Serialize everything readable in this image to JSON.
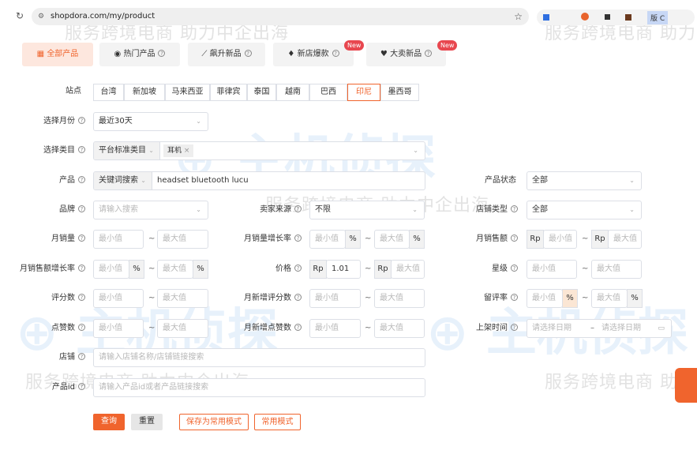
{
  "browser": {
    "url": "shopdora.com/my/product",
    "ext_label": "版 C"
  },
  "watermark": {
    "slogan": "服务跨境电商 助力中企出海",
    "logo": "主机侦探"
  },
  "tabs": [
    {
      "label": "全部产品",
      "icon": "grid-icon"
    },
    {
      "label": "热门产品",
      "icon": "award-icon"
    },
    {
      "label": "飙升新品",
      "icon": "trend-up-icon"
    },
    {
      "label": "新店爆款",
      "icon": "flame-icon",
      "badge": "New"
    },
    {
      "label": "大卖新品",
      "icon": "trophy-icon",
      "badge": "New"
    }
  ],
  "station": {
    "label": "站点",
    "options": [
      "台湾",
      "新加坡",
      "马来西亚",
      "菲律宾",
      "泰国",
      "越南",
      "巴西",
      "印尼",
      "墨西哥"
    ],
    "selected": "印尼"
  },
  "month": {
    "label": "选择月份",
    "value": "最近30天"
  },
  "category": {
    "label": "选择类目",
    "type": "平台标准类目",
    "tag": "耳机"
  },
  "product": {
    "label": "产品",
    "mode": "关键词搜索",
    "value": "headset bluetooth lucu"
  },
  "product_status": {
    "label": "产品状态",
    "value": "全部"
  },
  "brand": {
    "label": "品牌",
    "placeholder": "请输入搜索"
  },
  "seller_source": {
    "label": "卖家来源",
    "value": "不限"
  },
  "shop_type": {
    "label": "店铺类型",
    "value": "全部"
  },
  "ph": {
    "min": "最小值",
    "max": "最大值",
    "date": "请选择日期",
    "tilde": "~",
    "dash": "–",
    "percent": "%",
    "currency": "Rp"
  },
  "monthly_sales": {
    "label": "月销量"
  },
  "monthly_sales_growth": {
    "label": "月销量增长率"
  },
  "monthly_revenue": {
    "label": "月销售额"
  },
  "revenue_growth": {
    "label": "月销售额增长率"
  },
  "price": {
    "label": "价格",
    "min": "1.01"
  },
  "stars": {
    "label": "星级"
  },
  "ratings": {
    "label": "评分数"
  },
  "new_ratings": {
    "label": "月新增评分数"
  },
  "review_rate": {
    "label": "留评率"
  },
  "likes": {
    "label": "点赞数"
  },
  "new_likes": {
    "label": "月新增点赞数"
  },
  "listed_time": {
    "label": "上架时间"
  },
  "shop": {
    "label": "店铺",
    "placeholder": "请输入店铺名称/店铺链接搜索"
  },
  "product_id": {
    "label": "产品id",
    "placeholder": "请输入产品id或者产品链接搜索"
  },
  "buttons": {
    "query": "查询",
    "reset": "重置",
    "save": "保存为常用模式",
    "common": "常用模式"
  },
  "colors": {
    "accent": "#f0642d",
    "badge": "#e8474f"
  }
}
